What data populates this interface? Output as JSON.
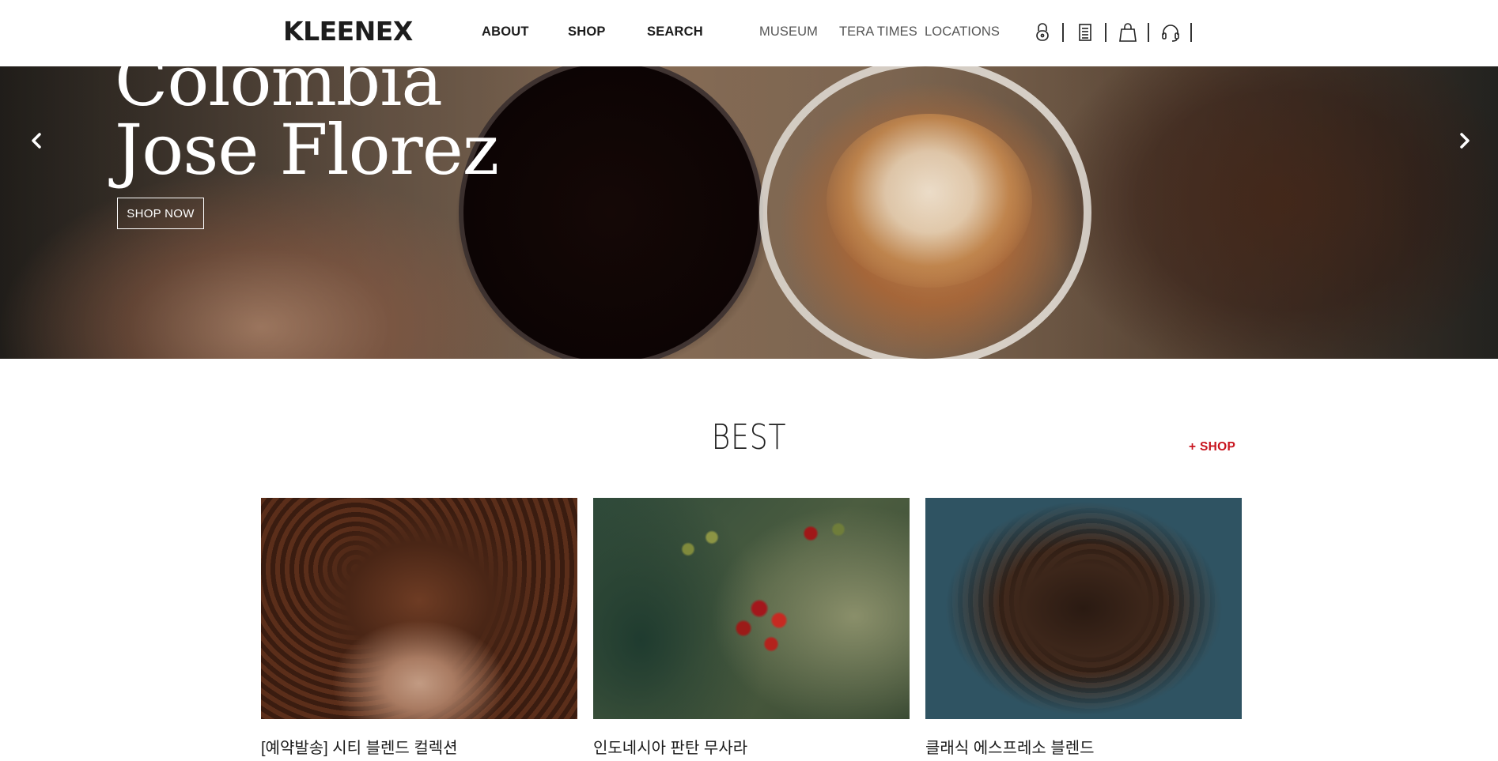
{
  "header": {
    "logo": "KLEENEX",
    "main_nav": [
      "ABOUT",
      "SHOP",
      "SEARCH"
    ],
    "sub_nav": [
      "MUSEUM",
      "TERA TIMES",
      "LOCATIONS"
    ],
    "utility_icons": [
      "lock-icon",
      "receipt-icon",
      "shopping-bag-icon",
      "headset-icon"
    ]
  },
  "hero": {
    "title_line1": "Colombia",
    "title_line2": "Jose Florez",
    "cta": "SHOP NOW",
    "prev_icon": "chevron-left-icon",
    "next_icon": "chevron-right-icon"
  },
  "best": {
    "title": "BEST",
    "shop_link": "+ SHOP",
    "products": [
      {
        "title": "[예약발송] 시티 블렌드 컬렉션"
      },
      {
        "title": "인도네시아 판탄 무사라"
      },
      {
        "title": "클래식 에스프레소 블렌드"
      }
    ]
  },
  "colors": {
    "accent": "#c8141e",
    "text": "#1b1b1b"
  }
}
